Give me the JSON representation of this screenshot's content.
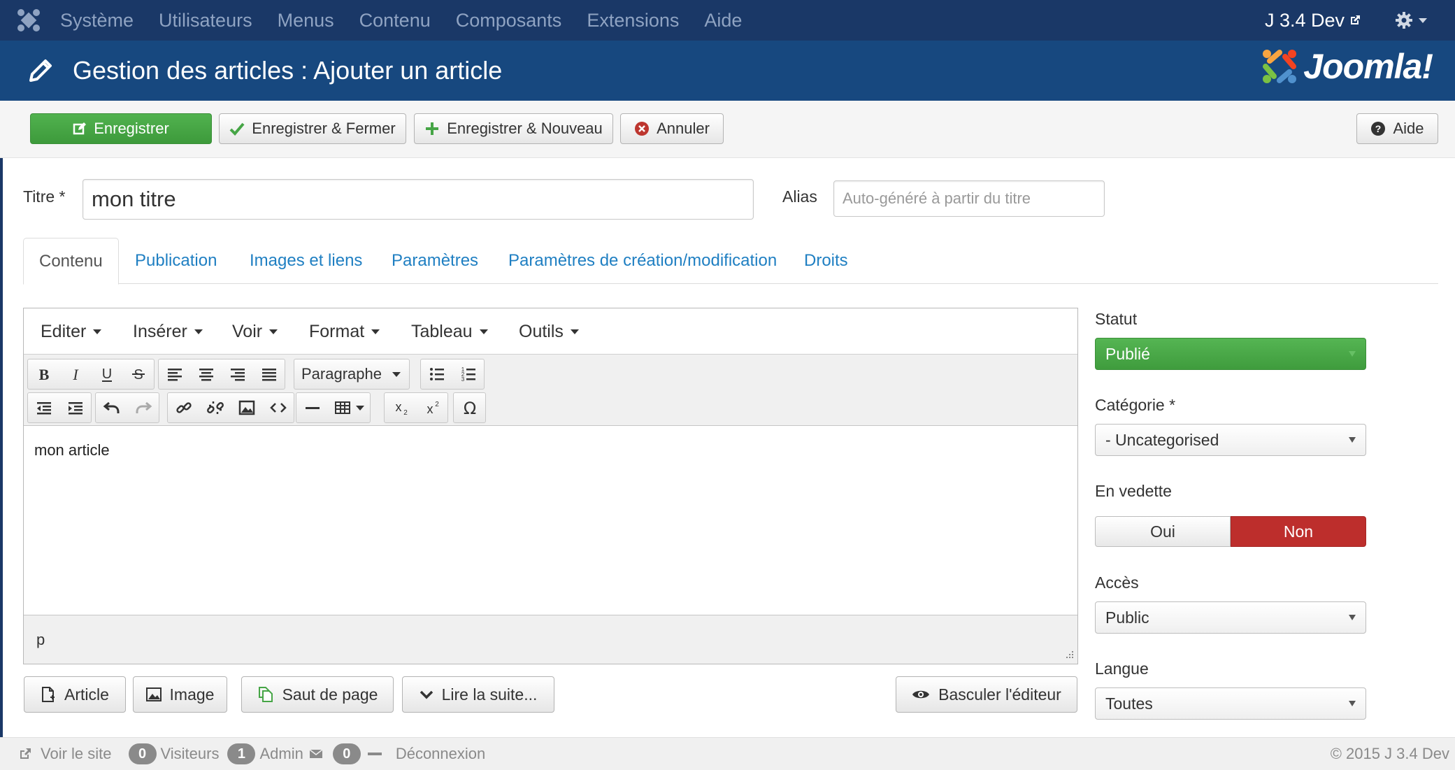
{
  "topnav": {
    "menu": [
      "Système",
      "Utilisateurs",
      "Menus",
      "Contenu",
      "Composants",
      "Extensions",
      "Aide"
    ],
    "site_label": "J 3.4 Dev"
  },
  "header": {
    "title": "Gestion des articles : Ajouter un article",
    "brand": "Joomla!"
  },
  "toolbar": {
    "save": "Enregistrer",
    "save_close": "Enregistrer & Fermer",
    "save_new": "Enregistrer & Nouveau",
    "cancel": "Annuler",
    "help": "Aide"
  },
  "form": {
    "title_label": "Titre *",
    "title_value": "mon titre",
    "alias_label": "Alias",
    "alias_placeholder": "Auto-généré à partir du titre"
  },
  "tabs": [
    "Contenu",
    "Publication",
    "Images et liens",
    "Paramètres",
    "Paramètres de création/modification",
    "Droits"
  ],
  "editor": {
    "menus": [
      "Editer",
      "Insérer",
      "Voir",
      "Format",
      "Tableau",
      "Outils"
    ],
    "format_select": "Paragraphe",
    "content": "mon article",
    "path": "p"
  },
  "editor_buttons": {
    "article": "Article",
    "image": "Image",
    "pagebreak": "Saut de page",
    "readmore": "Lire la suite...",
    "toggle": "Basculer l'éditeur"
  },
  "sidebar": {
    "status_label": "Statut",
    "status_value": "Publié",
    "category_label": "Catégorie *",
    "category_value": "- Uncategorised",
    "featured_label": "En vedette",
    "featured_yes": "Oui",
    "featured_no": "Non",
    "access_label": "Accès",
    "access_value": "Public",
    "language_label": "Langue",
    "language_value": "Toutes"
  },
  "footer": {
    "view_site": "Voir le site",
    "visitors_count": "0",
    "visitors": "Visiteurs",
    "admin_count": "1",
    "admin": "Admin",
    "messages_count": "0",
    "logout": "Déconnexion",
    "copyright": "© 2015 J 3.4 Dev"
  },
  "colors": {
    "topnav_bg": "#1a3867",
    "header_bg": "#17487f",
    "success": "#46a546",
    "danger": "#bd2e2c",
    "link": "#1f7fc2"
  }
}
